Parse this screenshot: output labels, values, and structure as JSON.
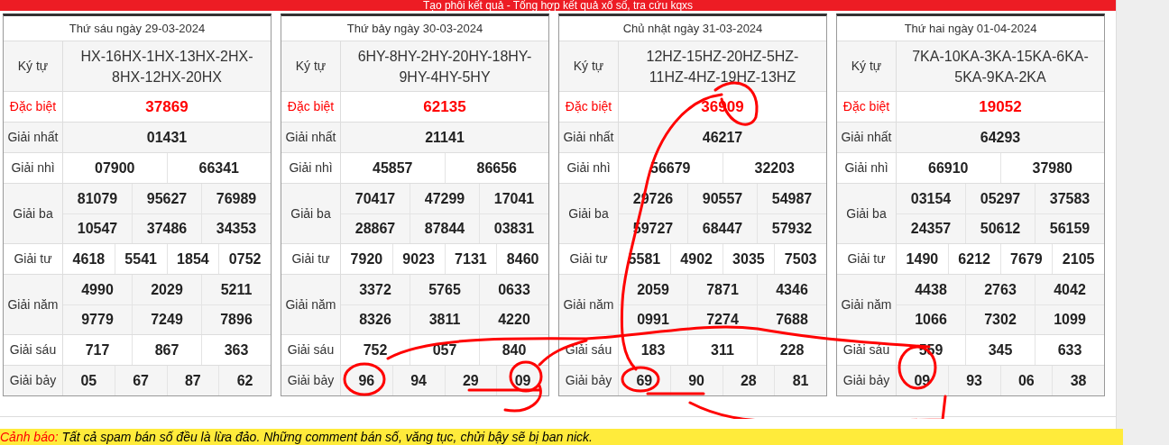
{
  "top_bar": {
    "text": "Tạo phôi kết quả - Tổng hợp kết quả xổ số, tra cứu kqxs"
  },
  "tables": [
    {
      "title": "Thứ sáu ngày 29-03-2024",
      "code_label": "Ký tự",
      "codes": "HX-16HX-1HX-13HX-2HX-8HX-12HX-20HX",
      "prizes": [
        {
          "label": "Đặc biệt",
          "kind": "special",
          "rows": [
            [
              "37869"
            ]
          ]
        },
        {
          "label": "Giải nhất",
          "kind": "normal",
          "rows": [
            [
              "01431"
            ]
          ]
        },
        {
          "label": "Giải nhì",
          "kind": "normal",
          "rows": [
            [
              "07900",
              "66341"
            ]
          ]
        },
        {
          "label": "Giải ba",
          "kind": "normal",
          "rows": [
            [
              "81079",
              "95627",
              "76989"
            ],
            [
              "10547",
              "37486",
              "34353"
            ]
          ]
        },
        {
          "label": "Giải tư",
          "kind": "normal",
          "rows": [
            [
              "4618",
              "5541",
              "1854",
              "0752"
            ]
          ]
        },
        {
          "label": "Giải năm",
          "kind": "normal",
          "rows": [
            [
              "4990",
              "2029",
              "5211"
            ],
            [
              "9779",
              "7249",
              "7896"
            ]
          ]
        },
        {
          "label": "Giải sáu",
          "kind": "normal",
          "rows": [
            [
              "717",
              "867",
              "363"
            ]
          ]
        },
        {
          "label": "Giải bảy",
          "kind": "normal",
          "rows": [
            [
              "05",
              "67",
              "87",
              "62"
            ]
          ]
        }
      ]
    },
    {
      "title": "Thứ bảy ngày 30-03-2024",
      "code_label": "Ký tự",
      "codes": "6HY-8HY-2HY-20HY-18HY-9HY-4HY-5HY",
      "prizes": [
        {
          "label": "Đặc biệt",
          "kind": "special",
          "rows": [
            [
              "62135"
            ]
          ]
        },
        {
          "label": "Giải nhất",
          "kind": "normal",
          "rows": [
            [
              "21141"
            ]
          ]
        },
        {
          "label": "Giải nhì",
          "kind": "normal",
          "rows": [
            [
              "45857",
              "86656"
            ]
          ]
        },
        {
          "label": "Giải ba",
          "kind": "normal",
          "rows": [
            [
              "70417",
              "47299",
              "17041"
            ],
            [
              "28867",
              "87844",
              "03831"
            ]
          ]
        },
        {
          "label": "Giải tư",
          "kind": "normal",
          "rows": [
            [
              "7920",
              "9023",
              "7131",
              "8460"
            ]
          ]
        },
        {
          "label": "Giải năm",
          "kind": "normal",
          "rows": [
            [
              "3372",
              "5765",
              "0633"
            ],
            [
              "8326",
              "3811",
              "4220"
            ]
          ]
        },
        {
          "label": "Giải sáu",
          "kind": "normal",
          "rows": [
            [
              "752",
              "057",
              "840"
            ]
          ]
        },
        {
          "label": "Giải bảy",
          "kind": "normal",
          "rows": [
            [
              "96",
              "94",
              "29",
              "09"
            ]
          ]
        }
      ]
    },
    {
      "title": "Chủ nhật ngày 31-03-2024",
      "code_label": "Ký tự",
      "codes": "12HZ-15HZ-20HZ-5HZ-11HZ-4HZ-19HZ-13HZ",
      "prizes": [
        {
          "label": "Đặc biệt",
          "kind": "special",
          "rows": [
            [
              "36909"
            ]
          ]
        },
        {
          "label": "Giải nhất",
          "kind": "normal",
          "rows": [
            [
              "46217"
            ]
          ]
        },
        {
          "label": "Giải nhì",
          "kind": "normal",
          "rows": [
            [
              "56679",
              "32203"
            ]
          ]
        },
        {
          "label": "Giải ba",
          "kind": "normal",
          "rows": [
            [
              "29726",
              "90557",
              "54987"
            ],
            [
              "59727",
              "68447",
              "57932"
            ]
          ]
        },
        {
          "label": "Giải tư",
          "kind": "normal",
          "rows": [
            [
              "5581",
              "4902",
              "3035",
              "7503"
            ]
          ]
        },
        {
          "label": "Giải năm",
          "kind": "normal",
          "rows": [
            [
              "2059",
              "7871",
              "4346"
            ],
            [
              "0991",
              "7274",
              "7688"
            ]
          ]
        },
        {
          "label": "Giải sáu",
          "kind": "normal",
          "rows": [
            [
              "183",
              "311",
              "228"
            ]
          ]
        },
        {
          "label": "Giải bảy",
          "kind": "normal",
          "rows": [
            [
              "69",
              "90",
              "28",
              "81"
            ]
          ]
        }
      ]
    },
    {
      "title": "Thứ hai ngày 01-04-2024",
      "code_label": "Ký tự",
      "codes": "7KA-10KA-3KA-15KA-6KA-5KA-9KA-2KA",
      "prizes": [
        {
          "label": "Đặc biệt",
          "kind": "special",
          "rows": [
            [
              "19052"
            ]
          ]
        },
        {
          "label": "Giải nhất",
          "kind": "normal",
          "rows": [
            [
              "64293"
            ]
          ]
        },
        {
          "label": "Giải nhì",
          "kind": "normal",
          "rows": [
            [
              "66910",
              "37980"
            ]
          ]
        },
        {
          "label": "Giải ba",
          "kind": "normal",
          "rows": [
            [
              "03154",
              "05297",
              "37583"
            ],
            [
              "24357",
              "50612",
              "56159"
            ]
          ]
        },
        {
          "label": "Giải tư",
          "kind": "normal",
          "rows": [
            [
              "1490",
              "6212",
              "7679",
              "2105"
            ]
          ]
        },
        {
          "label": "Giải năm",
          "kind": "normal",
          "rows": [
            [
              "4438",
              "2763",
              "4042"
            ],
            [
              "1066",
              "7302",
              "1099"
            ]
          ]
        },
        {
          "label": "Giải sáu",
          "kind": "normal",
          "rows": [
            [
              "559",
              "345",
              "633"
            ]
          ]
        },
        {
          "label": "Giải bảy",
          "kind": "normal",
          "rows": [
            [
              "09",
              "93",
              "06",
              "38"
            ]
          ]
        }
      ]
    }
  ],
  "warning": {
    "label": "Cảnh báo:",
    "text": "Tất cả spam bán số đều là lừa đảo. Những comment bán số, văng tục, chửi bậy sẽ bị ban nick."
  }
}
